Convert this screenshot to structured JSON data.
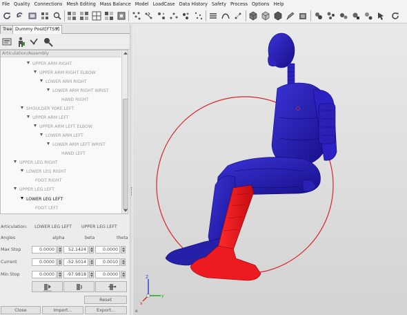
{
  "menubar": {
    "items": [
      "File",
      "Quality",
      "Connections",
      "Mesh Editing",
      "Mass Balance",
      "Model",
      "LoadCase",
      "Data History",
      "Safety",
      "Process",
      "Options",
      "Help"
    ]
  },
  "tabs": [
    {
      "label": "Tree",
      "active": false
    },
    {
      "label": "Dummy Posit[FTSS]",
      "active": true
    },
    {
      "label": "×",
      "active": false
    }
  ],
  "tree": {
    "header": "Articulation/Assembly",
    "nodes": [
      {
        "label": "UPPER ARM RIGHT",
        "expanded": true,
        "selected": false
      },
      {
        "label": "UPPER ARM RIGHT ELBOW",
        "expanded": true,
        "selected": false
      },
      {
        "label": "LOWER ARM RIGHT",
        "expanded": true,
        "selected": false
      },
      {
        "label": "LOWER ARM RIGHT WRIST",
        "expanded": true,
        "selected": false
      },
      {
        "label": "HAND RIGHT",
        "expanded": false,
        "selected": false
      },
      {
        "label": "SHOULDER YOKE LEFT",
        "expanded": true,
        "selected": false
      },
      {
        "label": "UPPER ARM LEFT",
        "expanded": true,
        "selected": false
      },
      {
        "label": "UPPER ARM LEFT ELBOW",
        "expanded": true,
        "selected": false
      },
      {
        "label": "LOWER ARM LEFT",
        "expanded": true,
        "selected": false
      },
      {
        "label": "LOWER ARM LEFT WRIST",
        "expanded": true,
        "selected": false
      },
      {
        "label": "HAND LEFT",
        "expanded": false,
        "selected": false
      },
      {
        "label": "UPPER LEG RIGHT",
        "expanded": true,
        "selected": false
      },
      {
        "label": "LOWER LEG RIGHT",
        "expanded": true,
        "selected": false
      },
      {
        "label": "FOOT RIGHT",
        "expanded": false,
        "selected": false
      },
      {
        "label": "UPPER LEG LEFT",
        "expanded": true,
        "selected": false
      },
      {
        "label": "LOWER LEG LEFT",
        "expanded": true,
        "selected": true
      },
      {
        "label": "FOOT LEFT",
        "expanded": false,
        "selected": false
      }
    ]
  },
  "articulation": {
    "label": "Articulation:",
    "joint_a": "LOWER LEG LEFT",
    "joint_b": "UPPER LEG LEFT",
    "angles_label": "Angles",
    "col_alpha": "alpha",
    "col_beta": "beta",
    "col_theta": "theta",
    "rows": [
      {
        "label": "Max Stop",
        "alpha": "0.0000",
        "beta": "52.1424",
        "theta": "0.0000"
      },
      {
        "label": "Current",
        "alpha": "0.0000",
        "beta": "-52.5014",
        "theta": "0.0010"
      },
      {
        "label": "Min Stop",
        "alpha": "0.0000",
        "beta": "-97.9818",
        "theta": "0.0000"
      }
    ],
    "reset_label": "Reset"
  },
  "footer": {
    "close_label": "Close",
    "import_label": "Import...",
    "export_label": "Export..."
  },
  "viewport": {
    "label": "e",
    "dummy_color": "#2c1fb8",
    "selected_part_color": "#e8141a",
    "circle_color": "#d6242a"
  }
}
